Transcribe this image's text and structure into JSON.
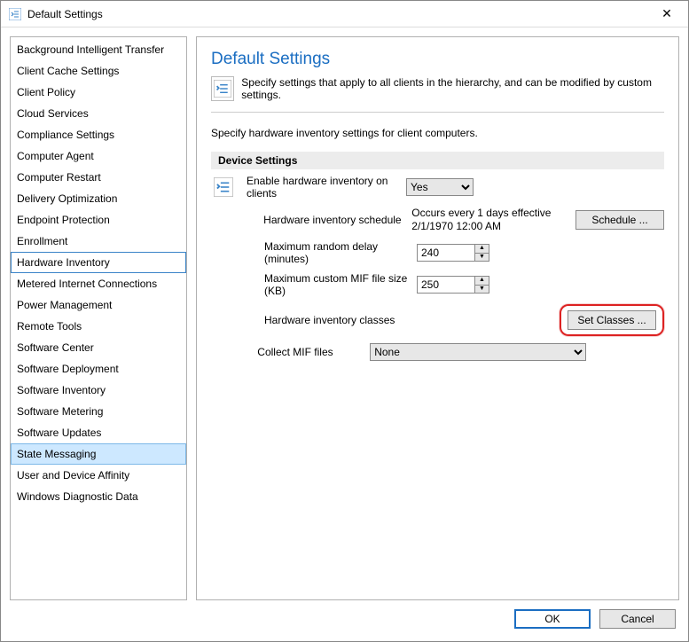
{
  "window": {
    "title": "Default Settings",
    "close_glyph": "✕"
  },
  "sidebar": {
    "items": [
      {
        "label": "Background Intelligent Transfer"
      },
      {
        "label": "Client Cache Settings"
      },
      {
        "label": "Client Policy"
      },
      {
        "label": "Cloud Services"
      },
      {
        "label": "Compliance Settings"
      },
      {
        "label": "Computer Agent"
      },
      {
        "label": "Computer Restart"
      },
      {
        "label": "Delivery Optimization"
      },
      {
        "label": "Endpoint Protection"
      },
      {
        "label": "Enrollment"
      },
      {
        "label": "Hardware Inventory"
      },
      {
        "label": "Metered Internet Connections"
      },
      {
        "label": "Power Management"
      },
      {
        "label": "Remote Tools"
      },
      {
        "label": "Software Center"
      },
      {
        "label": "Software Deployment"
      },
      {
        "label": "Software Inventory"
      },
      {
        "label": "Software Metering"
      },
      {
        "label": "Software Updates"
      },
      {
        "label": "State Messaging"
      },
      {
        "label": "User and Device Affinity"
      },
      {
        "label": "Windows Diagnostic Data"
      }
    ],
    "focused_index": 10,
    "selected_index": 19
  },
  "main": {
    "heading": "Default Settings",
    "subheading": "Specify settings that apply to all clients in the hierarchy, and can be modified by custom settings.",
    "intro": "Specify hardware inventory settings for client computers.",
    "section_title": "Device Settings",
    "rows": {
      "enable_hw_inv": {
        "label": "Enable hardware inventory on clients",
        "value": "Yes"
      },
      "schedule": {
        "label": "Hardware inventory schedule",
        "text": "Occurs every 1 days effective 2/1/1970 12:00 AM",
        "button": "Schedule ..."
      },
      "random_delay": {
        "label": "Maximum random delay (minutes)",
        "value": "240"
      },
      "mif_size": {
        "label": "Maximum custom MIF file size (KB)",
        "value": "250"
      },
      "hw_classes": {
        "label": "Hardware inventory classes",
        "button": "Set Classes ..."
      },
      "collect_mif": {
        "label": "Collect MIF files",
        "value": "None"
      }
    }
  },
  "footer": {
    "ok": "OK",
    "cancel": "Cancel"
  }
}
